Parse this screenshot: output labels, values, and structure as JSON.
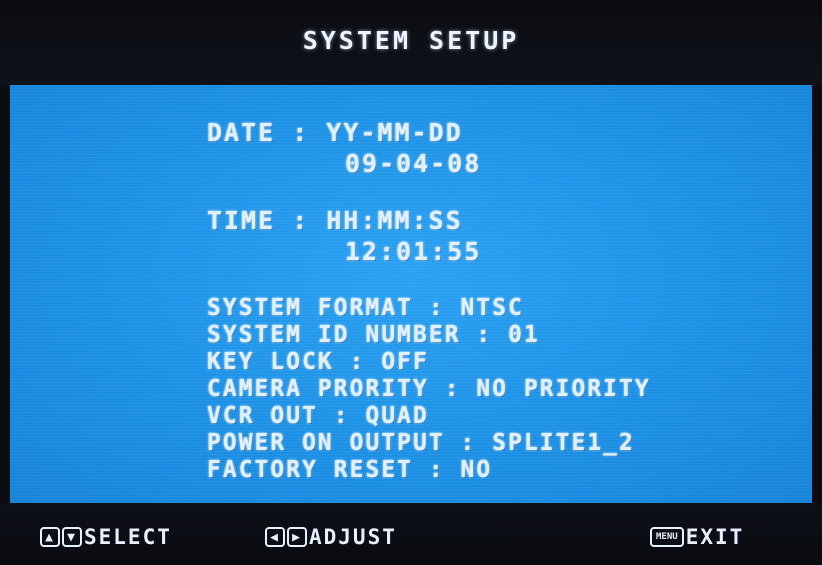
{
  "header": {
    "title": "SYSTEM SETUP"
  },
  "date": {
    "label_line": "DATE : YY-MM-DD",
    "value": "09-04-08"
  },
  "time": {
    "label_line": "TIME : HH:MM:SS",
    "value": "12:01:55"
  },
  "menu": {
    "items": [
      "SYSTEM FORMAT : NTSC",
      "SYSTEM ID NUMBER : 01",
      "KEY LOCK : OFF",
      "CAMERA PRORITY : NO PRIORITY",
      "VCR OUT : QUAD",
      "POWER ON OUTPUT : SPLITE1_2",
      "FACTORY RESET : NO"
    ]
  },
  "footer": {
    "select_label": "SELECT",
    "adjust_label": "ADJUST",
    "exit_label": "EXIT",
    "menu_key_label": "MENU",
    "up_key_glyph": "▲",
    "down_key_glyph": "▼",
    "left_key_glyph": "◀",
    "right_key_glyph": "▶"
  }
}
